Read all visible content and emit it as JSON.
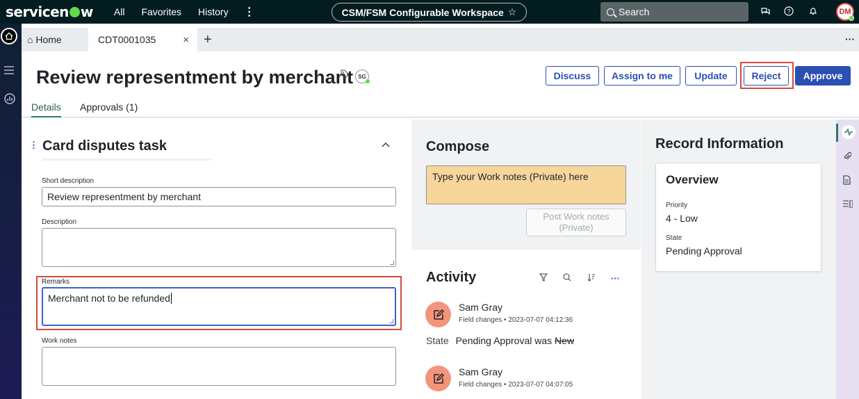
{
  "topnav": {
    "logo_pre": "servicen",
    "logo_post": "w",
    "all": "All",
    "favorites": "Favorites",
    "history": "History",
    "more": "⋮",
    "workspace": "CSM/FSM Configurable Workspace",
    "workspace_star": "☆",
    "search_placeholder": "Search",
    "avatar_initials": "DM"
  },
  "tabs": {
    "home": "⌂ Home",
    "record": "CDT0001035",
    "close": "×",
    "add": "+",
    "more": "···"
  },
  "header": {
    "title": "Review representment by merchant",
    "assignee_badge": "SG",
    "buttons": {
      "discuss": "Discuss",
      "assign": "Assign to me",
      "update": "Update",
      "reject": "Reject",
      "approve": "Approve"
    }
  },
  "subtabs": {
    "details": "Details",
    "approvals": "Approvals (1)"
  },
  "form": {
    "section_title": "Card disputes task",
    "short_description_label": "Short description",
    "short_description_value": "Review representment by merchant",
    "description_label": "Description",
    "description_value": "",
    "remarks_label": "Remarks",
    "remarks_value": "Merchant not to be refunded",
    "work_notes_label": "Work notes",
    "work_notes_value": ""
  },
  "compose": {
    "title": "Compose",
    "placeholder": "Type your Work notes (Private) here",
    "post_button_line1": "Post Work notes",
    "post_button_line2": "(Private)"
  },
  "activity": {
    "title": "Activity",
    "entries": [
      {
        "user": "Sam Gray",
        "meta": "Field changes • 2023-07-07 04:12:36",
        "change_field": "State",
        "change_new": "Pending Approval",
        "change_was": "was",
        "change_old": "New"
      },
      {
        "user": "Sam Gray",
        "meta": "Field changes • 2023-07-07 04:07:05"
      }
    ]
  },
  "record_info": {
    "title": "Record Information",
    "overview_title": "Overview",
    "priority_label": "Priority",
    "priority_value": "4 - Low",
    "state_label": "State",
    "state_value": "Pending Approval"
  },
  "colors": {
    "nav_bg": "#031c1f",
    "primary": "#2b4fb3",
    "highlight_red": "#d9483b",
    "compose_yellow": "#f7d69b",
    "activity_icon": "#f2957b"
  }
}
